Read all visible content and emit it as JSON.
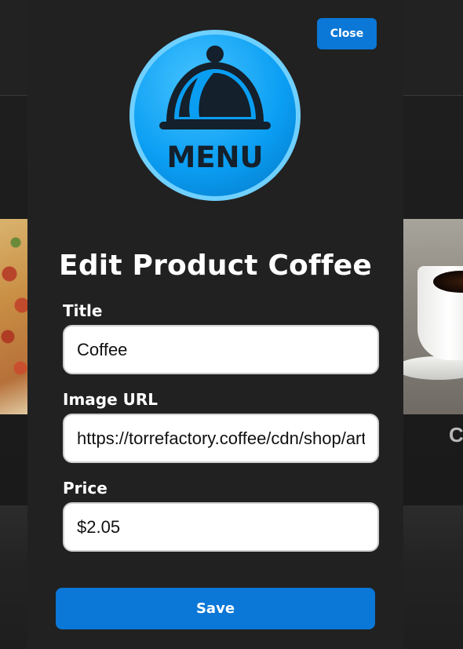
{
  "modal": {
    "close_label": "Close",
    "logo_text": "MENU",
    "title": "Edit Product Coffee",
    "fields": {
      "title": {
        "label": "Title",
        "value": "Coffee"
      },
      "image_url": {
        "label": "Image URL",
        "value": "https://torrefactory.coffee/cdn/shop/articles/coffee.jpg"
      },
      "price": {
        "label": "Price",
        "value": "$2.05"
      }
    },
    "save_label": "Save"
  },
  "background": {
    "right_card_label": "C"
  },
  "colors": {
    "accent": "#0b77d6",
    "modal_bg": "#212121",
    "page_bg": "#1c1c1c"
  },
  "icons": {
    "logo": "menu-cloche-icon"
  }
}
